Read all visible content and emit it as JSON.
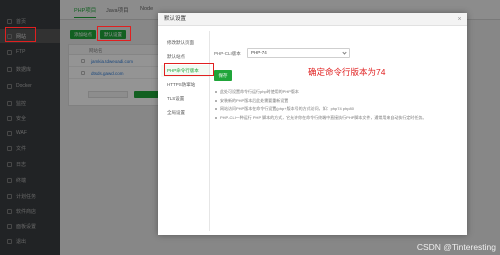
{
  "sidebar": {
    "items": [
      {
        "label": "首页",
        "icon": "home-icon"
      },
      {
        "label": "网站",
        "icon": "globe-icon"
      },
      {
        "label": "FTP",
        "icon": "ftp-icon"
      },
      {
        "label": "数据库",
        "icon": "database-icon"
      },
      {
        "label": "Docker",
        "icon": "docker-icon"
      },
      {
        "label": "监控",
        "icon": "monitor-icon"
      },
      {
        "label": "安全",
        "icon": "shield-icon"
      },
      {
        "label": "WAF",
        "icon": "firewall-icon"
      },
      {
        "label": "文件",
        "icon": "folder-icon"
      },
      {
        "label": "日志",
        "icon": "log-icon"
      },
      {
        "label": "终端",
        "icon": "terminal-icon"
      },
      {
        "label": "计划任务",
        "icon": "clock-icon"
      },
      {
        "label": "软件商店",
        "icon": "store-icon"
      },
      {
        "label": "面板设置",
        "icon": "gear-icon"
      },
      {
        "label": "退出",
        "icon": "logout-icon"
      }
    ]
  },
  "topbar": {
    "tabs": [
      "PHP项目",
      "Java项目",
      "Node"
    ]
  },
  "toolbar": {
    "add_site_label": "添加站点",
    "default_settings_label": "默认设置"
  },
  "table": {
    "header": "网站名",
    "rows": [
      "jamkia.tdweoadi.com",
      "dtsds.gawd.com"
    ]
  },
  "modal": {
    "title": "默认设置",
    "close_glyph": "×",
    "nav": [
      "修改默认页面",
      "默认站点",
      "PHP命令行版本",
      "HTTPS防窜站",
      "TLS设置",
      "全局设置"
    ],
    "active_nav": "PHP命令行版本",
    "php_cli_label": "PHP-CLI版本",
    "php_version_value": "PHP-74",
    "save_label": "保存",
    "annotation": "确定命令行版本为74",
    "notes": [
      "此处可设置命令行运行php时使用的PHP版本",
      "安装新的PHP版本后此处需要重新设置",
      "网站访问PHP版本在命令行设置(php+版本号的方式访问，如：php74 php80",
      "PHP-CLI一种运行 PHP 脚本的方式，它允许你在命令行终端中直接执行PHP脚本文件，通常用来自动执行定时任务。"
    ]
  },
  "watermark": "CSDN @Tinteresting",
  "colors": {
    "accent": "#20a53a",
    "highlight": "#e02020",
    "sidebar_bg": "#3a3d40"
  }
}
